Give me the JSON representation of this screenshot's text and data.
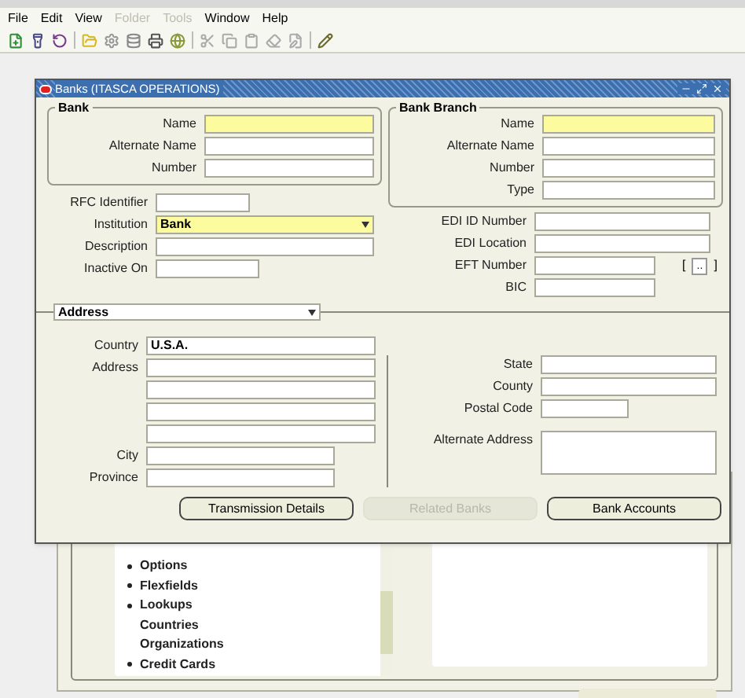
{
  "menu": [
    {
      "label": "File",
      "disabled": false
    },
    {
      "label": "Edit",
      "disabled": false
    },
    {
      "label": "View",
      "disabled": false
    },
    {
      "label": "Folder",
      "disabled": true
    },
    {
      "label": "Tools",
      "disabled": true
    },
    {
      "label": "Window",
      "disabled": false
    },
    {
      "label": "Help",
      "disabled": false
    }
  ],
  "dialog": {
    "title": "Banks (ITASCA OPERATIONS)",
    "bank": {
      "title": "Bank",
      "fields": [
        {
          "label": "Name",
          "required": true
        },
        {
          "label": "Alternate Name",
          "required": false
        },
        {
          "label": "Number",
          "required": false
        }
      ]
    },
    "branch": {
      "title": "Bank Branch",
      "fields": [
        {
          "label": "Name",
          "required": true
        },
        {
          "label": "Alternate Name",
          "required": false
        },
        {
          "label": "Number",
          "required": false
        },
        {
          "label": "Type",
          "required": false
        }
      ]
    },
    "left_fields": [
      {
        "label": "RFC Identifier",
        "required": false
      },
      {
        "label": "Institution",
        "value": "Bank",
        "required": true,
        "kind": "dropdown"
      },
      {
        "label": "Description",
        "required": false
      },
      {
        "label": "Inactive On",
        "required": false
      }
    ],
    "right_fields": [
      {
        "label": "EDI ID Number",
        "required": false
      },
      {
        "label": "EDI Location",
        "required": false
      },
      {
        "label": "EFT Number",
        "required": false,
        "flexfield": {
          "open": "[",
          "button": "..",
          "close": "]"
        }
      },
      {
        "label": "BIC",
        "required": false
      }
    ],
    "address_selector": "Address",
    "address_left": [
      {
        "label": "Country",
        "value": "U.S.A.",
        "required": false
      },
      {
        "label": "Address",
        "required": false
      },
      {
        "required": false
      },
      {
        "required": false
      },
      {
        "required": false
      },
      {
        "label": "City",
        "required": false
      },
      {
        "label": "Province",
        "required": false
      }
    ],
    "address_right": [
      {
        "label": "State",
        "required": false
      },
      {
        "label": "County",
        "required": false
      },
      {
        "label": "Postal Code",
        "required": false
      },
      {
        "label": "Alternate Address",
        "required": false,
        "kind": "textarea"
      }
    ],
    "buttons": [
      {
        "label": "Transmission Details",
        "disabled": false
      },
      {
        "label": "Related Banks",
        "disabled": true
      },
      {
        "label": "Bank Accounts",
        "disabled": false
      }
    ]
  },
  "navigator": {
    "items": [
      {
        "label": "Options",
        "kind": "bullet"
      },
      {
        "label": "Flexfields",
        "kind": "bullet"
      },
      {
        "label": "Lookups",
        "kind": "bullet"
      },
      {
        "label": "Countries",
        "kind": "sub"
      },
      {
        "label": "Organizations",
        "kind": "sub"
      },
      {
        "label": "Credit Cards",
        "kind": "bullet"
      }
    ]
  }
}
